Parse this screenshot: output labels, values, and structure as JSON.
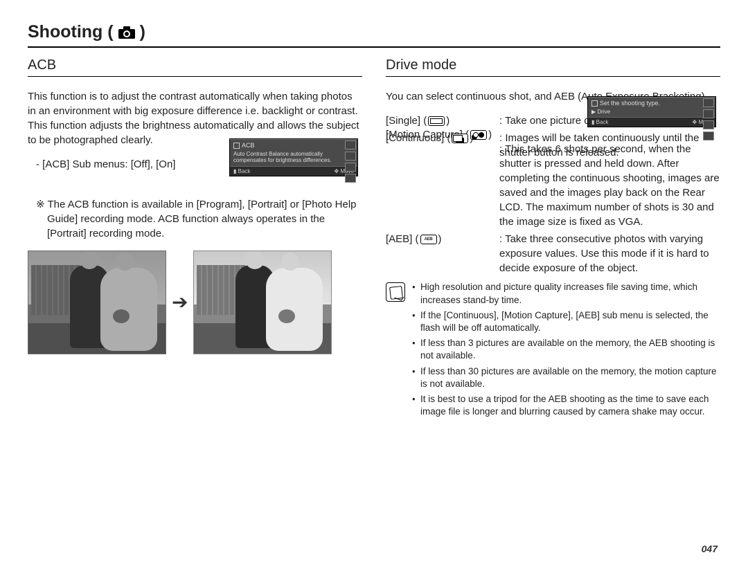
{
  "page": {
    "title": "Shooting (",
    "title_close": ")",
    "number": "047"
  },
  "acb": {
    "heading": "ACB",
    "intro": "This function is to adjust the contrast automatically when taking photos in an environment with big exposure difference i.e. backlight or contrast. This function adjusts the brightness automatically and allows the subject to be photographed clearly.",
    "submenus": "- [ACB] Sub menus: [Off], [On]",
    "note": "※ The ACB function is available in [Program], [Portrait] or [Photo Help Guide] recording mode. ACB function always operates in the [Portrait] recording mode.",
    "lcd": {
      "label": "ACB",
      "desc": "Auto Contrast Balance automatically compensates for brightness differences.",
      "back": "Back",
      "move": "Move"
    }
  },
  "drive": {
    "heading": "Drive mode",
    "intro": "You can select continuous shot, and AEB (Auto Exposure Bracketing).",
    "modes": {
      "single_name": "[Single]",
      "single_desc": ": Take one picture only.",
      "continuous_name": "[Continuous]",
      "continuous_desc": ": Images will be taken continuously until the shutter button is released.",
      "motion_name": "[Motion Capture]",
      "motion_desc": ": This takes 6 shots per second, when the shutter is pressed and held down. After completing the continuous shooting, images are saved and the images play back on the Rear LCD. The maximum number of shots is 30 and the image size is fixed as VGA.",
      "aeb_name": "[AEB]",
      "aeb_chip_text": "AEB",
      "aeb_desc": ": Take three consecutive photos with varying exposure values. Use this mode if it is hard to decide exposure of the object."
    },
    "lcd": {
      "title": "Set the shooting type.",
      "sub": "Drive",
      "back": "Back",
      "move": "Move"
    },
    "notes": [
      "High resolution and picture quality increases file saving time, which increases stand-by time.",
      "If the [Continuous], [Motion Capture], [AEB] sub menu is selected, the flash will be off automatically.",
      "If less than 3 pictures are available on the memory, the AEB shooting is not available.",
      "If less than 30 pictures are available on the memory, the motion capture is not available.",
      "It is best to use a tripod for the AEB shooting as the time to save each image file is longer and blurring caused by camera shake may occur."
    ]
  }
}
